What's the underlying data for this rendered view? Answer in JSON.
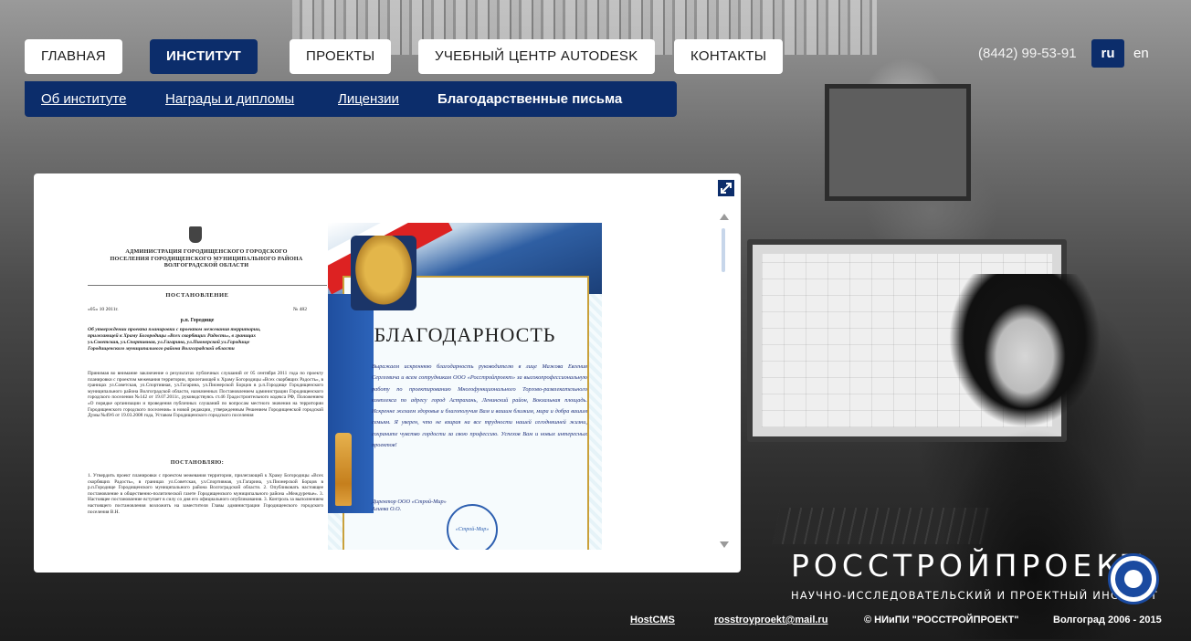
{
  "nav": {
    "items": [
      {
        "label": "ГЛАВНАЯ",
        "active": false
      },
      {
        "label": "ИНСТИТУТ",
        "active": true
      },
      {
        "label": "ПРОЕКТЫ",
        "active": false
      },
      {
        "label": "УЧЕБНЫЙ ЦЕНТР AUTODESK",
        "active": false
      },
      {
        "label": "КОНТАКТЫ",
        "active": false
      }
    ]
  },
  "subnav": {
    "items": [
      {
        "label": "Об институте"
      },
      {
        "label": "Награды и дипломы"
      },
      {
        "label": "Лицензии"
      },
      {
        "label": "Благодарственные письма",
        "current": true
      }
    ]
  },
  "header": {
    "phone": "(8442) 99-53-91",
    "lang_ru": "ru",
    "lang_en": "en"
  },
  "colors": {
    "brand_blue": "#0c2d6b"
  },
  "gallery": {
    "doc1": {
      "header": "АДМИНИСТРАЦИЯ ГОРОДИЩЕНСКОГО ГОРОДСКОГО ПОСЕЛЕНИЯ ГОРОДИЩЕНСКОГО МУНИЦИПАЛЬНОГО РАЙОНА ВОЛГОГРАДСКОЙ ОБЛАСТИ",
      "title": "ПОСТАНОВЛЕНИЕ",
      "date_left": "«05» 10 2011г.",
      "date_right": "№ 482",
      "place": "р.п. Городище",
      "subject": "Об утверждении проекта планировки с проектом межевания территории, прилегающей к Храму Богородицы «Всех скорбящих Радость», в границах ул.Советская, ул.Спортивная, ул.Гагарина, ул.Пионерской ул.Городище Городищенского муниципального района Волгоградской области",
      "body": "Принимая во внимание заключение о результатах публичных слушаний от 05 сентября 2011 года по проекту планировки с проектом межевания территории, прилегающей к Храму Богородицы «Всех скорбящих Радость», в границах ул.Советская, ул.Спортивная, ул.Гагарина, ул.Пионерской Борцов в р.п.Городище Городищенского муниципального района Волгоградской области, назначенных Постановлением администрации Городищенского городского поселения №142 от 19.07.2011г., руководствуясь ст.46 Градостроительного кодекса РФ, Положением «О порядке организации и проведения публичных слушаний по вопросам местного значения на территории Городищенского городского поселения» в новой редакции, утвержденным Решением Городищенской городской Думы №49/6 от 19.03.2008 года, Уставом Городищенского городского поселения",
      "decree": "ПОСТАНОВЛЯЮ:",
      "body2": "1. Утвердить проект планировки с проектом межевания территории, прилегающей к Храму Богородицы «Всех скорбящих Радость», в границах ул.Советская, ул.Спортивная, ул.Гагарина, ул.Пионерской Борцов в р.п.Городище Городищенского муниципального района Волгоградской области. 2. Опубликовать настоящее постановление в общественно-политической газете Городищенского муниципального района «Междуречье». 3. Настоящее постановление вступает в силу со дня его официального опубликования. 3. Контроль за выполнением настоящего постановления возложить на заместителя Главы администрации Городищенского городского поселения В.Н."
    },
    "doc2": {
      "title": "БЛАГОДАРНОСТЬ",
      "text": "Выражаем искреннюю благодарность руководителю в лице Мажова Евгения Сергеевича и всем сотрудникам ООО «Росстройпроект» за высокопрофессиональную работу по проектированию Многофункционального Торгово-развлекательного комплекса по адресу город Астрахань, Ленинский район, Вокзальная площадь. Искренне желаем здоровья и благополучия Вам и вашим близким, мира и добра вашим семьям. Я уверен, что не взирая на все трудности нашей сегодняшней жизни, сохраните чувство гордости за свою профессию. Успехов Вам и новых интересных проектов!",
      "signature": "Директор ООО «Строй-Мир»",
      "signer": "Алиева О.О.",
      "stamp": "«Строй-Мир»"
    }
  },
  "logo": {
    "name": "РОССТРОЙПРОЕКТ",
    "subtitle": "НАУЧНО-ИССЛЕДОВАТЕЛЬСКИЙ И ПРОЕКТНЫЙ ИНСТИТУТ"
  },
  "footer": {
    "cms": "HostCMS",
    "email": "rosstroyproekt@mail.ru",
    "copyright": "© НИиПИ \"РОССТРОЙПРОЕКТ\"",
    "city_years": "Волгоград 2006 - 2015"
  }
}
